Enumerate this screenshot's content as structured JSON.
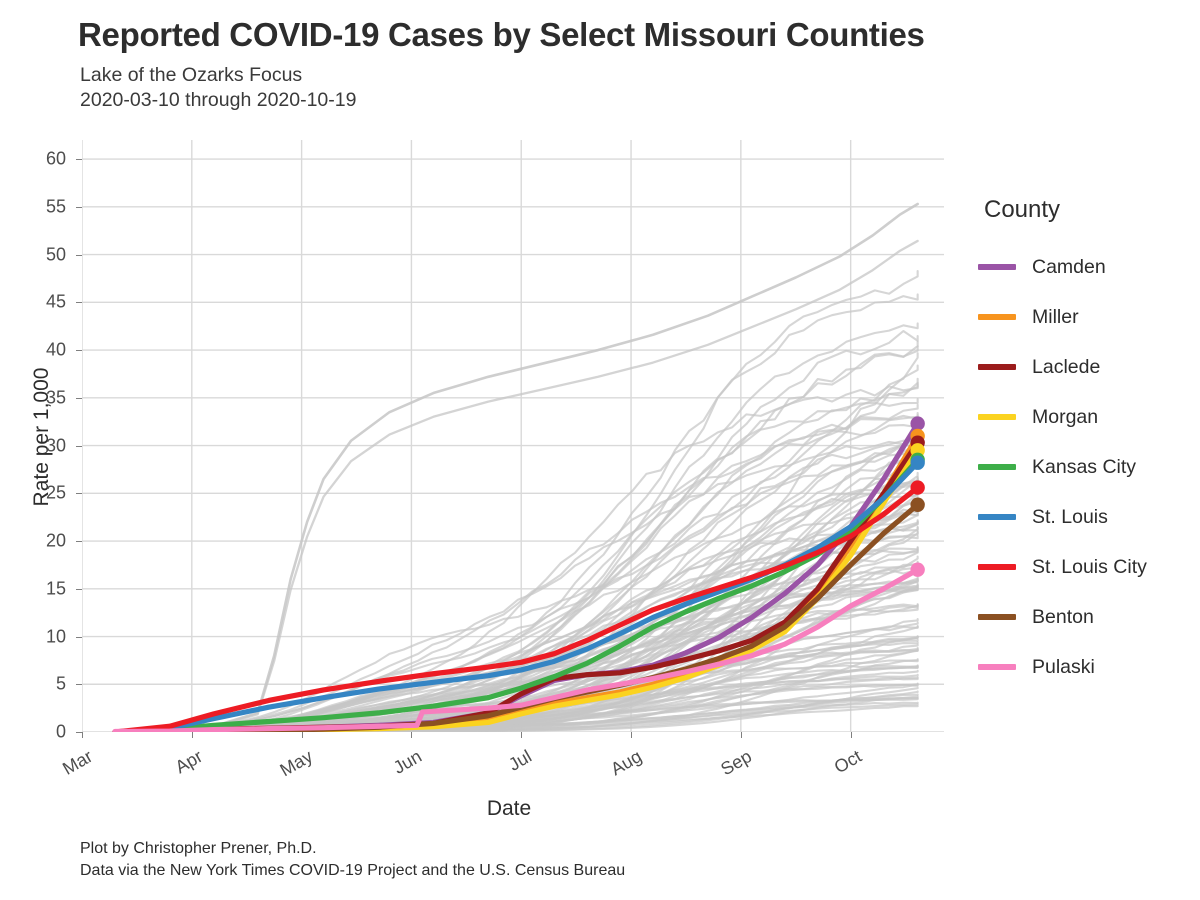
{
  "title": "Reported COVID-19 Cases by Select Missouri Counties",
  "subtitle": "Lake of the Ozarks Focus\n2020-03-10 through 2020-10-19",
  "caption": "Plot by Christopher Prener, Ph.D.\nData via the New York Times COVID-19 Project and the U.S. Census Bureau",
  "legend": {
    "title": "County",
    "items": [
      {
        "label": "Camden",
        "color": "#9A54A6"
      },
      {
        "label": "Miller",
        "color": "#F7941E"
      },
      {
        "label": "Laclede",
        "color": "#9B1C1C"
      },
      {
        "label": "Morgan",
        "color": "#FBD320"
      },
      {
        "label": "Kansas City",
        "color": "#3DAE49"
      },
      {
        "label": "St. Louis",
        "color": "#3585C4"
      },
      {
        "label": "St. Louis City",
        "color": "#ED1C24"
      },
      {
        "label": "Benton",
        "color": "#8B5022"
      },
      {
        "label": "Pulaski",
        "color": "#F77FBE"
      }
    ]
  },
  "chart_data": {
    "type": "line",
    "title": "Reported COVID-19 Cases by Select Missouri Counties",
    "subtitle": "Lake of the Ozarks Focus",
    "date_range": "2020-03-10 through 2020-10-19",
    "xlabel": "Date",
    "ylabel": "Rate per 1,000",
    "ylim": [
      0,
      62
    ],
    "yticks": [
      0,
      5,
      10,
      15,
      20,
      25,
      30,
      35,
      40,
      45,
      50,
      55,
      60
    ],
    "xticks": [
      "Mar",
      "Apr",
      "May",
      "Jun",
      "Jul",
      "Aug",
      "Sep",
      "Oct"
    ],
    "xtick_positions": [
      0.0,
      1.0,
      2.0,
      3.0,
      4.0,
      5.0,
      6.0,
      7.0
    ],
    "grid": true,
    "grid_color": "#D9D9D9",
    "legend_position": "right",
    "background_color": "#FFFFFF",
    "background_series_color": "#C6C6C6",
    "background_series_note": "Light gray lines show all other Missouri counties (unhighlighted)",
    "x_units": "months since March 1, 2020 (data end at 2020-10-19 = 7.61)",
    "x_end": 7.61,
    "endpoint_markers": true,
    "series": [
      {
        "name": "Camden",
        "color": "#9A54A6",
        "x": [
          0.3,
          0.8,
          1.2,
          1.7,
          2.2,
          2.7,
          3.2,
          3.7,
          4.0,
          4.3,
          4.6,
          4.9,
          5.2,
          5.5,
          5.8,
          6.1,
          6.4,
          6.7,
          7.0,
          7.3,
          7.61
        ],
        "values": [
          0.0,
          0.05,
          0.2,
          0.35,
          0.5,
          0.7,
          1.0,
          2.0,
          3.8,
          5.4,
          6.0,
          6.3,
          7.0,
          8.3,
          9.9,
          12.0,
          14.5,
          17.5,
          21.5,
          26.5,
          32.3
        ],
        "final_value": 32.3
      },
      {
        "name": "Miller",
        "color": "#F7941E",
        "x": [
          0.3,
          0.8,
          1.2,
          1.7,
          2.2,
          2.7,
          3.2,
          3.7,
          4.0,
          4.3,
          4.6,
          4.9,
          5.2,
          5.5,
          5.8,
          6.1,
          6.4,
          6.7,
          7.0,
          7.3,
          7.61
        ],
        "values": [
          0.0,
          0.0,
          0.1,
          0.2,
          0.3,
          0.4,
          0.7,
          1.3,
          2.2,
          3.0,
          3.6,
          4.2,
          5.0,
          6.0,
          7.3,
          9.0,
          11.0,
          14.5,
          19.5,
          25.0,
          31.0
        ],
        "final_value": 31.0
      },
      {
        "name": "Laclede",
        "color": "#9B1C1C",
        "x": [
          0.3,
          0.8,
          1.2,
          1.7,
          2.2,
          2.7,
          3.2,
          3.7,
          4.0,
          4.3,
          4.6,
          4.9,
          5.2,
          5.5,
          5.8,
          6.1,
          6.4,
          6.7,
          7.0,
          7.3,
          7.61
        ],
        "values": [
          0.0,
          0.1,
          0.3,
          0.4,
          0.5,
          0.6,
          0.9,
          2.0,
          4.0,
          5.6,
          6.0,
          6.2,
          6.8,
          7.6,
          8.5,
          9.6,
          11.5,
          15.0,
          20.0,
          25.0,
          30.3
        ],
        "final_value": 30.3
      },
      {
        "name": "Morgan",
        "color": "#FBD320",
        "x": [
          0.3,
          0.8,
          1.2,
          1.7,
          2.2,
          2.7,
          3.2,
          3.7,
          4.0,
          4.3,
          4.6,
          4.9,
          5.2,
          5.5,
          5.8,
          6.1,
          6.4,
          6.7,
          7.0,
          7.3,
          7.61
        ],
        "values": [
          0.0,
          0.0,
          0.05,
          0.15,
          0.25,
          0.35,
          0.55,
          1.0,
          1.9,
          2.7,
          3.3,
          3.9,
          4.7,
          5.7,
          7.0,
          8.6,
          10.5,
          14.0,
          18.5,
          24.0,
          29.5
        ],
        "final_value": 29.5
      },
      {
        "name": "Kansas City",
        "color": "#3DAE49",
        "x": [
          0.3,
          0.8,
          1.2,
          1.7,
          2.2,
          2.7,
          3.2,
          3.7,
          4.0,
          4.3,
          4.6,
          4.9,
          5.2,
          5.5,
          5.8,
          6.1,
          6.4,
          6.7,
          7.0,
          7.3,
          7.61
        ],
        "values": [
          0.0,
          0.3,
          0.7,
          1.1,
          1.5,
          2.0,
          2.7,
          3.6,
          4.6,
          5.8,
          7.2,
          9.0,
          11.0,
          12.6,
          14.0,
          15.3,
          16.8,
          18.6,
          21.0,
          24.5,
          28.5
        ],
        "final_value": 28.5
      },
      {
        "name": "St. Louis",
        "color": "#3585C4",
        "x": [
          0.3,
          0.8,
          1.2,
          1.7,
          2.2,
          2.7,
          3.2,
          3.7,
          4.0,
          4.3,
          4.6,
          4.9,
          5.2,
          5.5,
          5.8,
          6.1,
          6.4,
          6.7,
          7.0,
          7.3,
          7.61
        ],
        "values": [
          0.0,
          0.4,
          1.4,
          2.6,
          3.6,
          4.5,
          5.2,
          5.9,
          6.5,
          7.4,
          8.7,
          10.3,
          12.0,
          13.4,
          14.7,
          16.0,
          17.5,
          19.3,
          21.5,
          24.5,
          28.2
        ],
        "final_value": 28.2
      },
      {
        "name": "St. Louis City",
        "color": "#ED1C24",
        "x": [
          0.3,
          0.8,
          1.2,
          1.7,
          2.2,
          2.7,
          3.2,
          3.7,
          4.0,
          4.3,
          4.6,
          4.9,
          5.2,
          5.5,
          5.8,
          6.1,
          6.4,
          6.7,
          7.0,
          7.3,
          7.61
        ],
        "values": [
          0.0,
          0.6,
          1.9,
          3.3,
          4.4,
          5.3,
          6.1,
          6.8,
          7.3,
          8.2,
          9.6,
          11.2,
          12.8,
          14.0,
          15.1,
          16.2,
          17.4,
          18.8,
          20.5,
          22.8,
          25.6
        ],
        "final_value": 25.6
      },
      {
        "name": "Benton",
        "color": "#8B5022",
        "x": [
          0.3,
          0.8,
          1.2,
          1.7,
          2.2,
          2.7,
          3.2,
          3.7,
          4.0,
          4.3,
          4.6,
          4.9,
          5.2,
          5.5,
          5.8,
          6.1,
          6.4,
          6.7,
          7.0,
          7.3,
          7.61
        ],
        "values": [
          0.0,
          0.0,
          0.05,
          0.15,
          0.3,
          0.5,
          0.9,
          1.7,
          2.6,
          3.5,
          4.2,
          4.9,
          5.7,
          6.6,
          7.7,
          9.0,
          11.0,
          14.0,
          17.5,
          20.8,
          23.8
        ],
        "final_value": 23.8
      },
      {
        "name": "Pulaski",
        "color": "#F77FBE",
        "x": [
          0.3,
          0.8,
          1.2,
          1.7,
          2.2,
          2.7,
          3.05,
          3.1,
          3.4,
          3.7,
          4.0,
          4.3,
          4.6,
          4.9,
          5.2,
          5.5,
          5.8,
          6.1,
          6.4,
          6.7,
          7.0,
          7.3,
          7.61
        ],
        "values": [
          0.05,
          0.1,
          0.25,
          0.35,
          0.45,
          0.6,
          0.7,
          2.1,
          2.3,
          2.5,
          2.8,
          3.6,
          4.4,
          5.0,
          5.6,
          6.3,
          7.1,
          8.0,
          9.2,
          11.0,
          13.2,
          15.0,
          17.0
        ],
        "final_value": 17.0
      }
    ],
    "background_outlier": {
      "note": "Highest gray county trajectory peaks at about 55 per 1,000",
      "peak_value": 55.3
    }
  }
}
